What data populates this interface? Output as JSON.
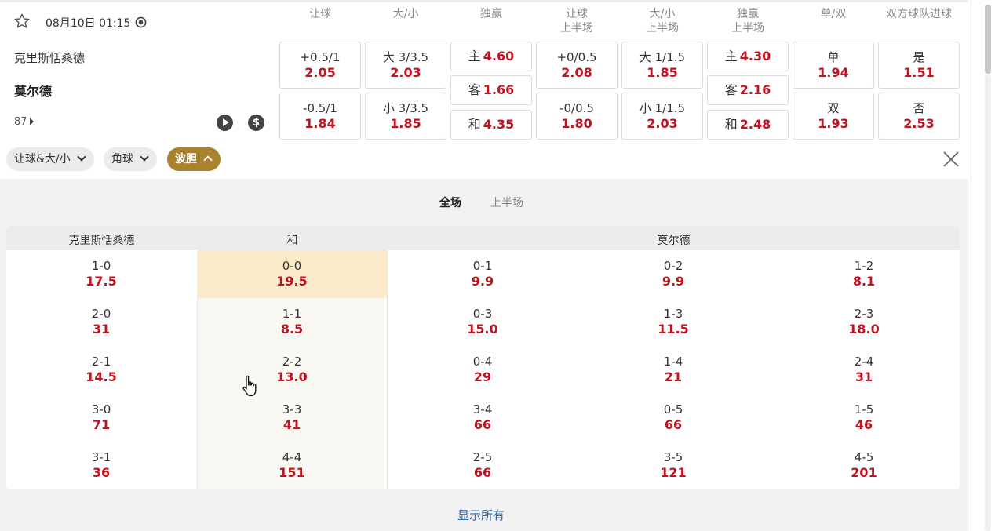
{
  "match": {
    "time": "08月10日 01:15",
    "home": "克里斯恬桑德",
    "away": "莫尔德",
    "minute": "87"
  },
  "columns": [
    {
      "line1": "让球",
      "line2": ""
    },
    {
      "line1": "大/小",
      "line2": ""
    },
    {
      "line1": "独赢",
      "line2": ""
    },
    {
      "line1": "让球",
      "line2": "上半场"
    },
    {
      "line1": "大/小",
      "line2": "上半场"
    },
    {
      "line1": "独赢",
      "line2": "上半场"
    },
    {
      "line1": "单/双",
      "line2": ""
    },
    {
      "line1": "双方球队进球",
      "line2": ""
    }
  ],
  "markets": {
    "handicap": [
      {
        "label": "+0.5/1",
        "odds": "2.05"
      },
      {
        "label": "-0.5/1",
        "odds": "1.84"
      }
    ],
    "over_under": [
      {
        "label": "大 3/3.5",
        "odds": "2.03"
      },
      {
        "label": "小 3/3.5",
        "odds": "1.85"
      }
    ],
    "moneyline": [
      {
        "label": "主",
        "odds": "4.60"
      },
      {
        "label": "客",
        "odds": "1.66"
      },
      {
        "label": "和",
        "odds": "4.35"
      }
    ],
    "handicap_1h": [
      {
        "label": "+0/0.5",
        "odds": "2.08"
      },
      {
        "label": "-0/0.5",
        "odds": "1.80"
      }
    ],
    "over_under_1h": [
      {
        "label": "大 1/1.5",
        "odds": "1.85"
      },
      {
        "label": "小 1/1.5",
        "odds": "2.03"
      }
    ],
    "moneyline_1h": [
      {
        "label": "主",
        "odds": "4.30"
      },
      {
        "label": "客",
        "odds": "2.16"
      },
      {
        "label": "和",
        "odds": "2.48"
      }
    ],
    "odd_even": [
      {
        "label": "单",
        "odds": "1.94"
      },
      {
        "label": "双",
        "odds": "1.93"
      }
    ],
    "btts": [
      {
        "label": "是",
        "odds": "1.51"
      },
      {
        "label": "否",
        "odds": "2.53"
      }
    ]
  },
  "filters": [
    {
      "label": "让球&大/小"
    },
    {
      "label": "角球"
    },
    {
      "label": "波胆"
    }
  ],
  "tabs": {
    "full": "全场",
    "half": "上半场"
  },
  "correct_score": {
    "header_home": "克里斯恬桑德",
    "header_draw": "和",
    "header_away": "莫尔德",
    "columns": [
      [
        {
          "score": "1-0",
          "odds": "17.5"
        },
        {
          "score": "2-0",
          "odds": "31"
        },
        {
          "score": "2-1",
          "odds": "14.5"
        },
        {
          "score": "3-0",
          "odds": "71"
        },
        {
          "score": "3-1",
          "odds": "36"
        }
      ],
      [
        {
          "score": "0-0",
          "odds": "19.5"
        },
        {
          "score": "1-1",
          "odds": "8.5"
        },
        {
          "score": "2-2",
          "odds": "13.0"
        },
        {
          "score": "3-3",
          "odds": "41"
        },
        {
          "score": "4-4",
          "odds": "151"
        }
      ],
      [
        {
          "score": "0-1",
          "odds": "9.9"
        },
        {
          "score": "0-3",
          "odds": "15.0"
        },
        {
          "score": "0-4",
          "odds": "29"
        },
        {
          "score": "3-4",
          "odds": "66"
        },
        {
          "score": "2-5",
          "odds": "66"
        }
      ],
      [
        {
          "score": "0-2",
          "odds": "9.9"
        },
        {
          "score": "1-3",
          "odds": "11.5"
        },
        {
          "score": "1-4",
          "odds": "21"
        },
        {
          "score": "0-5",
          "odds": "66"
        },
        {
          "score": "3-5",
          "odds": "121"
        }
      ],
      [
        {
          "score": "1-2",
          "odds": "8.1"
        },
        {
          "score": "2-3",
          "odds": "18.0"
        },
        {
          "score": "2-4",
          "odds": "31"
        },
        {
          "score": "1-5",
          "odds": "46"
        },
        {
          "score": "4-5",
          "odds": "201"
        }
      ]
    ]
  },
  "show_all": "显示所有",
  "colors": {
    "odds": "#c1121f",
    "accent": "#a8822f",
    "highlight": "#fbebcb",
    "link": "#2b6cb0"
  },
  "icons": [
    "star-icon",
    "live-icon",
    "play-icon",
    "dollar-icon",
    "close-icon",
    "hand-cursor-icon"
  ]
}
